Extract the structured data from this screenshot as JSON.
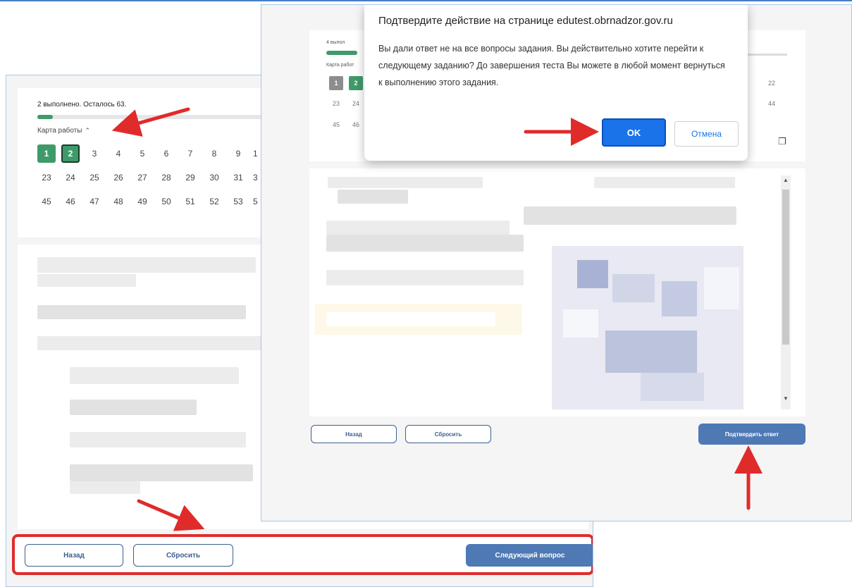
{
  "left_screen": {
    "progress_text": "2 выполнено. Осталось 63.",
    "progress_fraction": 0.03,
    "work_map_label": "Карта работы",
    "map_rows": [
      [
        {
          "n": "1",
          "state": "done"
        },
        {
          "n": "2",
          "state": "current"
        },
        {
          "n": "3"
        },
        {
          "n": "4"
        },
        {
          "n": "5"
        },
        {
          "n": "6"
        },
        {
          "n": "7"
        },
        {
          "n": "8"
        },
        {
          "n": "9"
        },
        {
          "n": "1",
          "cut": true
        }
      ],
      [
        {
          "n": "23"
        },
        {
          "n": "24"
        },
        {
          "n": "25"
        },
        {
          "n": "26"
        },
        {
          "n": "27"
        },
        {
          "n": "28"
        },
        {
          "n": "29"
        },
        {
          "n": "30"
        },
        {
          "n": "31"
        },
        {
          "n": "3",
          "cut": true
        }
      ],
      [
        {
          "n": "45"
        },
        {
          "n": "46"
        },
        {
          "n": "47"
        },
        {
          "n": "48"
        },
        {
          "n": "49"
        },
        {
          "n": "50"
        },
        {
          "n": "51"
        },
        {
          "n": "52"
        },
        {
          "n": "53"
        },
        {
          "n": "5",
          "cut": true
        }
      ]
    ],
    "back_label": "Назад",
    "reset_label": "Сбросить",
    "next_label": "Следующий вопрос"
  },
  "right_screen": {
    "progress_text": "4 выпол",
    "map_label": "Карта работ",
    "row1": [
      "1",
      "2"
    ],
    "row1_right": "22",
    "row2": [
      "23",
      "24"
    ],
    "row2_right": "44",
    "row3": [
      "45",
      "46"
    ],
    "back_label": "Назад",
    "reset_label": "Сбросить",
    "confirm_label": "Подтвердить ответ",
    "dialog": {
      "title": "Подтвердите действие на странице edutest.obrnadzor.gov.ru",
      "message": "Вы дали ответ не на все вопросы задания. Вы действительно хотите перейти к следующему заданию? До завершения теста Вы можете в любой момент вернуться к выполнению этого задания.",
      "ok_label": "OK",
      "cancel_label": "Отмена"
    }
  },
  "colors": {
    "green": "#3f9a6a",
    "primary_blue": "#4e79b5",
    "dark_navy": "#193a5e",
    "annotation_red": "#e02b2b",
    "dialog_blue": "#1a73e8"
  },
  "icons": {
    "chevron": "chevron-up-icon",
    "copy": "copy-icon"
  }
}
